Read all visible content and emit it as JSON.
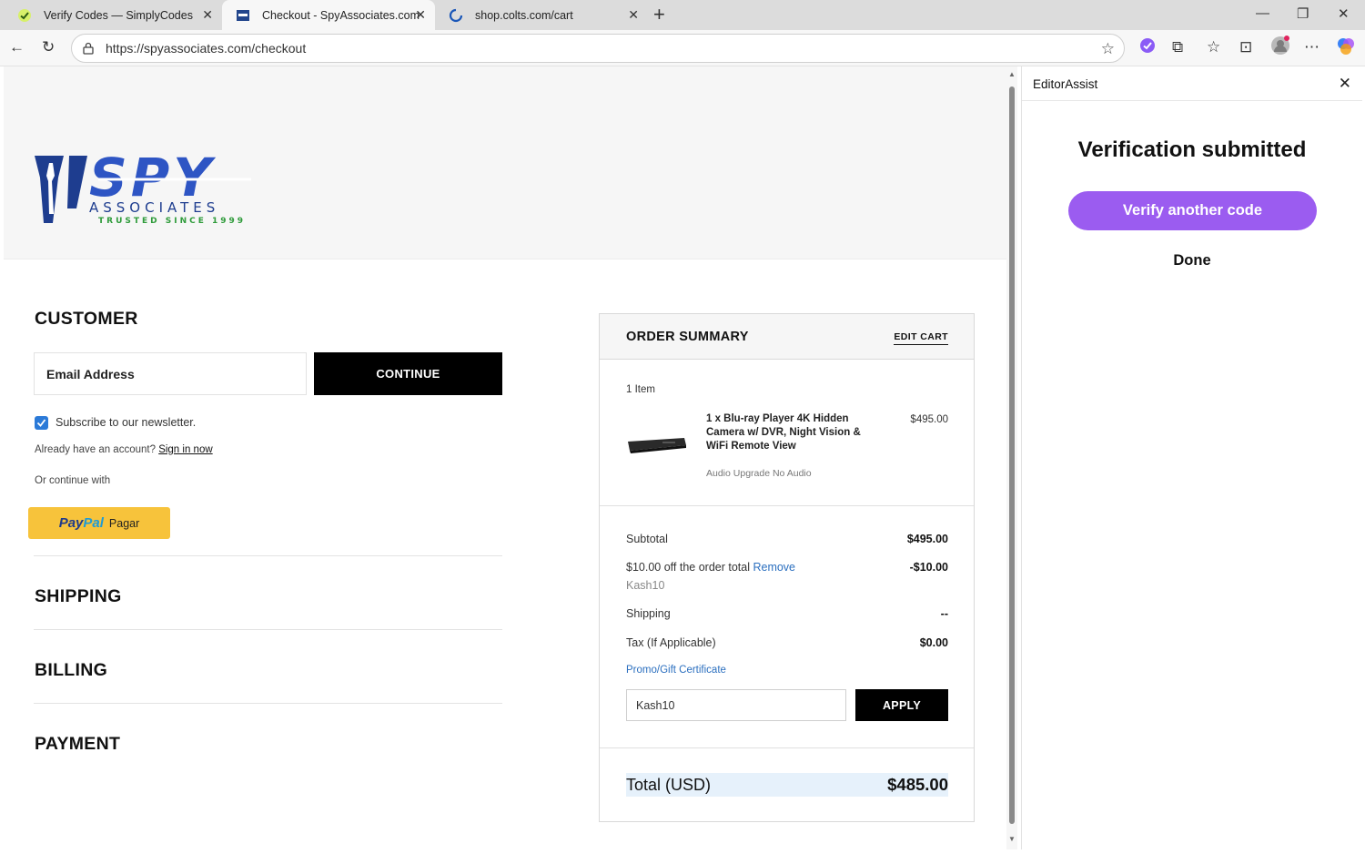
{
  "browser": {
    "tabs": [
      {
        "title": "Verify Codes — SimplyCodes",
        "active": false
      },
      {
        "title": "Checkout - SpyAssociates.com",
        "active": true
      },
      {
        "title": "shop.colts.com/cart",
        "active": false
      }
    ],
    "url": "https://spyassociates.com/checkout"
  },
  "logo": {
    "name": "SPY",
    "sub": "ASSOCIATES",
    "tagline": "TRUSTED SINCE 1999"
  },
  "customer": {
    "title": "CUSTOMER",
    "email_placeholder": "Email Address",
    "continue_label": "CONTINUE",
    "newsletter_label": "Subscribe to our newsletter.",
    "newsletter_checked": true,
    "account_prompt": "Already have an account?",
    "signin_label": "Sign in now",
    "continue_with": "Or continue with",
    "paypal_label": "Pagar"
  },
  "sections": {
    "shipping": "SHIPPING",
    "billing": "BILLING",
    "payment": "PAYMENT"
  },
  "order_summary": {
    "title": "ORDER SUMMARY",
    "edit_cart": "EDIT CART",
    "item_count": "1 Item",
    "item": {
      "name": "1 x Blu-ray Player 4K Hidden Camera w/ DVR, Night Vision & WiFi Remote View",
      "price": "$495.00",
      "option": "Audio Upgrade No Audio"
    },
    "subtotal_label": "Subtotal",
    "subtotal": "$495.00",
    "discount_label": "$10.00 off the order total",
    "remove_label": "Remove",
    "discount_value": "-$10.00",
    "discount_code": "Kash10",
    "shipping_label": "Shipping",
    "shipping_value": "--",
    "tax_label": "Tax (If Applicable)",
    "tax_value": "$0.00",
    "promo_label": "Promo/Gift Certificate",
    "promo_value": "Kash10",
    "apply_label": "APPLY",
    "total_label": "Total (USD)",
    "total_value": "$485.00"
  },
  "side_panel": {
    "title": "EditorAssist",
    "heading": "Verification submitted",
    "verify_another": "Verify another code",
    "done": "Done"
  }
}
